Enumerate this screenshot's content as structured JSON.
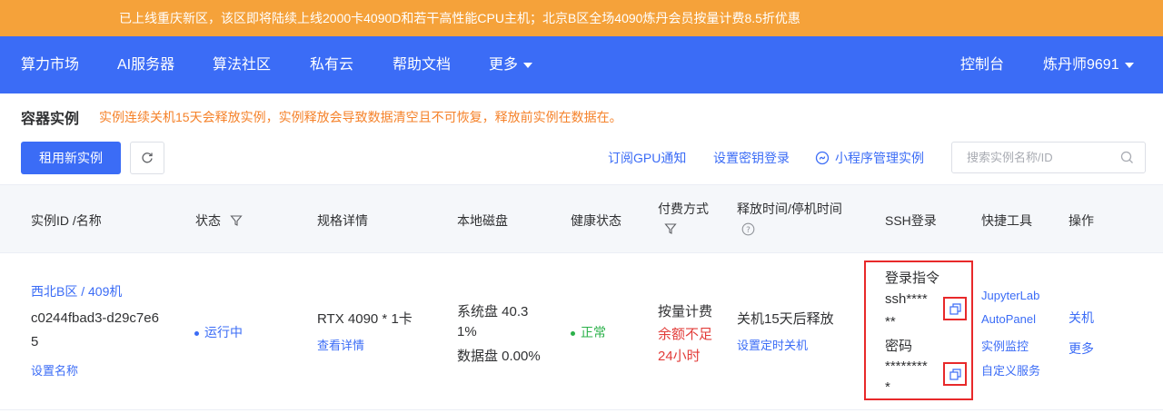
{
  "banner": {
    "text": "已上线重庆新区，该区即将陆续上线2000卡4090D和若干高性能CPU主机；北京B区全场4090炼丹会员按量计费8.5折优惠"
  },
  "nav": {
    "items": [
      "算力市场",
      "AI服务器",
      "算法社区",
      "私有云",
      "帮助文档",
      "更多"
    ],
    "console": "控制台",
    "user": "炼丹师9691"
  },
  "page": {
    "title": "容器实例",
    "tip": "实例连续关机15天会释放实例，实例释放会导致数据清空且不可恢复，释放前实例在数据在。"
  },
  "toolbar": {
    "new_instance": "租用新实例",
    "subscribe_gpu": "订阅GPU通知",
    "set_key": "设置密钥登录",
    "miniapp": "小程序管理实例",
    "search_placeholder": "搜索实例名称/ID"
  },
  "table": {
    "headers": {
      "id_name": "实例ID /名称",
      "status": "状态",
      "spec": "规格详情",
      "disk": "本地磁盘",
      "health": "健康状态",
      "billing_l1": "付费方式",
      "release_l1": "释放时间/停机时间",
      "ssh": "SSH登录",
      "tools": "快捷工具",
      "ops": "操作"
    },
    "row": {
      "region": "西北B区 / 409机",
      "id_l1": "c0244fbad3-d29c7e6",
      "id_l2": "5",
      "set_name": "设置名称",
      "status": "运行中",
      "spec": "RTX 4090 * 1卡",
      "spec_detail": "查看详情",
      "disk_sys_l1": "系统盘 40.3",
      "disk_sys_l2": "1%",
      "disk_data": "数据盘 0.00%",
      "health": "正常",
      "billing": "按量计费",
      "balance_l1": "余额不足",
      "balance_l2": "24小时",
      "release": "关机15天后释放",
      "schedule": "设置定时关机",
      "ssh_cmd_label": "登录指令",
      "ssh_cmd_l1": "ssh****",
      "ssh_cmd_l2": "**",
      "ssh_pwd_label": "密码",
      "ssh_pwd_l1": "********",
      "ssh_pwd_l2": "*",
      "tools": [
        "JupyterLab",
        "AutoPanel",
        "实例监控",
        "自定义服务"
      ],
      "op_shutdown": "关机",
      "op_more": "更多"
    }
  },
  "colors": {
    "banner": "#f5a23a",
    "primary": "#3b6cf6",
    "warning": "#f5822a",
    "danger": "#e23c39",
    "success": "#2bb14a",
    "highlight": "#e8292a"
  }
}
